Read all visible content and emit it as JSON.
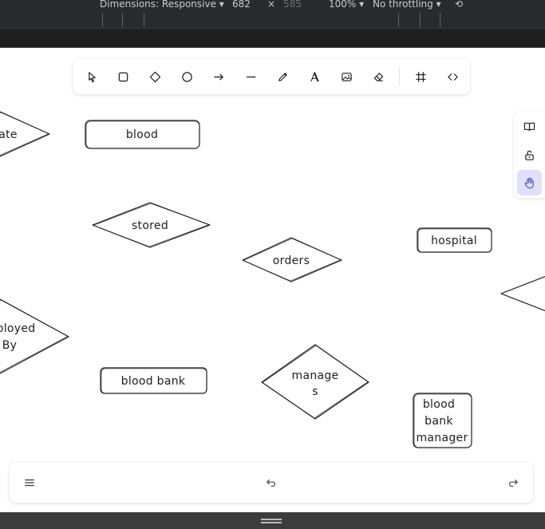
{
  "devtools": {
    "dimensions_label": "Dimensions: Responsive",
    "width_value": "682",
    "times_sign": "×",
    "height_value": "585",
    "zoom_label": "100%",
    "throttling_label": "No throttling"
  },
  "toolbar": {
    "tools": [
      {
        "name": "selection-tool",
        "icon": "pointer-icon"
      },
      {
        "name": "rectangle-tool",
        "icon": "square-icon"
      },
      {
        "name": "diamond-tool",
        "icon": "diamond-icon"
      },
      {
        "name": "ellipse-tool",
        "icon": "circle-icon"
      },
      {
        "name": "arrow-tool",
        "icon": "arrow-right-icon"
      },
      {
        "name": "line-tool",
        "icon": "line-icon"
      },
      {
        "name": "draw-tool",
        "icon": "pencil-icon"
      },
      {
        "name": "text-tool",
        "icon": "text-icon"
      },
      {
        "name": "image-tool",
        "icon": "image-icon"
      },
      {
        "name": "eraser-tool",
        "icon": "eraser-icon"
      },
      {
        "name": "frame-tool",
        "icon": "frame-icon"
      },
      {
        "name": "embed-tool",
        "icon": "code-icon"
      }
    ]
  },
  "side_panel": [
    {
      "name": "library-button",
      "icon": "book-icon"
    },
    {
      "name": "lock-button",
      "icon": "unlock-icon"
    },
    {
      "name": "hand-tool-button",
      "icon": "hand-icon",
      "active": true
    }
  ],
  "diagram": {
    "shapes": {
      "rel_partial_top": "ate",
      "entity_blood": "blood",
      "rel_stored": "stored",
      "rel_orders": "orders",
      "entity_hospital": "hospital",
      "rel_employed_line1": "ployed",
      "rel_employed_line2": "By",
      "entity_blood_bank": "blood bank",
      "rel_manages_line1": "manage",
      "rel_manages_line2": "s",
      "entity_manager_line1": "blood",
      "entity_manager_line2": "bank",
      "entity_manager_line3": "manager"
    }
  },
  "footer": {
    "menu_icon": "hamburger-icon",
    "undo_icon": "undo-icon",
    "redo_icon": "redo-icon"
  },
  "colors": {
    "accent": "#e0dfff",
    "accent_text": "#4a47b1",
    "stroke": "#1e1e1e"
  }
}
